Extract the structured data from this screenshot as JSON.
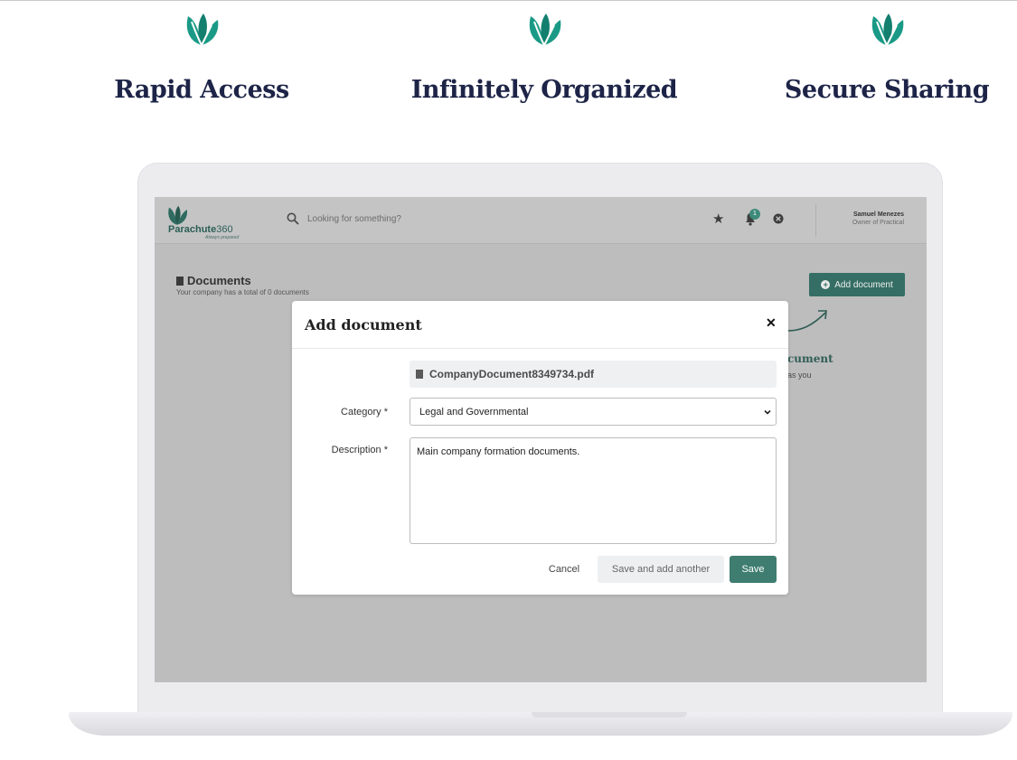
{
  "features": [
    {
      "title": "Rapid Access",
      "icon": "parachute-leaf-icon"
    },
    {
      "title": "Infinitely Organized",
      "icon": "parachute-leaf-icon"
    },
    {
      "title": "Secure Sharing",
      "icon": "parachute-leaf-icon"
    }
  ],
  "colors": {
    "brand": "#1a9a86",
    "heading": "#1d2447",
    "primary_button": "#346e64"
  },
  "app": {
    "logo_text_bold": "Parachute",
    "logo_text_light": "360",
    "logo_tagline": "Always prepared",
    "search_placeholder": "Looking for something?",
    "notification_count": "1",
    "user_name": "Samuel Menezes",
    "user_role": "Owner of Practical"
  },
  "page": {
    "title": "Documents",
    "subtitle": "Your company has a total of 0 documents",
    "add_button_label": "Add document",
    "empty_heading": "cument",
    "empty_text": "as you"
  },
  "modal": {
    "title": "Add document",
    "file_name": "CompanyDocument8349734.pdf",
    "category_label": "Category *",
    "category_value": "Legal and Governmental",
    "description_label": "Description *",
    "description_value": "Main company formation documents.",
    "cancel_label": "Cancel",
    "save_another_label": "Save and add another",
    "save_label": "Save"
  }
}
